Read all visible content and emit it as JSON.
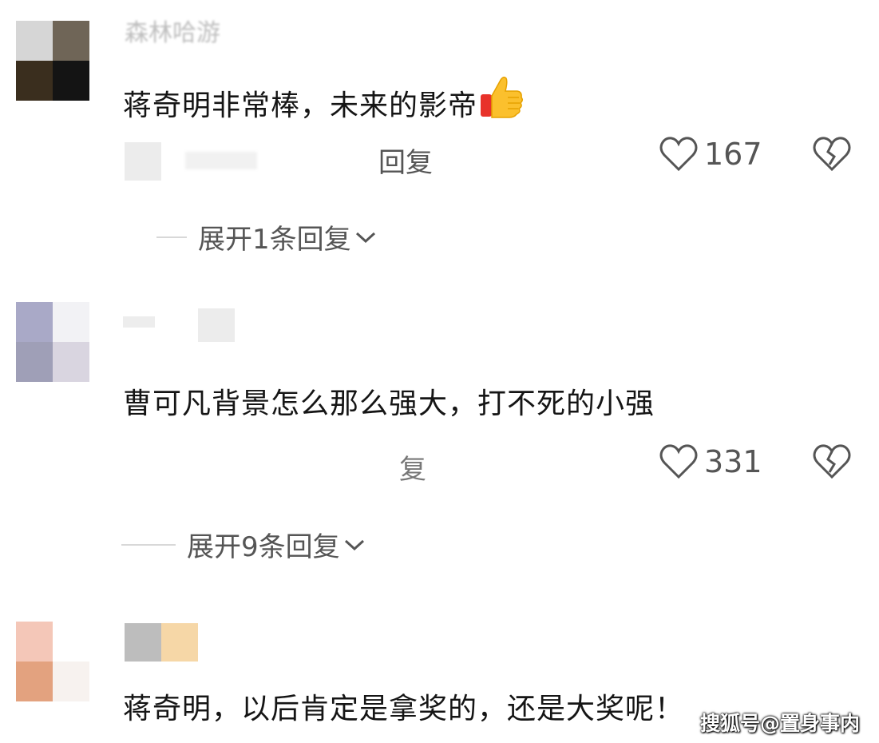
{
  "comments": [
    {
      "username": "森林哈游",
      "text": "蒋奇明非常棒，未来的影帝",
      "reply_label": "回复",
      "like_count": "167",
      "expand_label": "展开1条回复",
      "avatar_colors": [
        "#d6d6d6",
        "#6f6557",
        "#3a2e1e",
        "#141414"
      ]
    },
    {
      "username": "",
      "text": "曹可凡背景怎么那么强大，打不死的小强",
      "reply_label": "复",
      "like_count": "331",
      "expand_label": "展开9条回复",
      "avatar_colors": [
        "#a9a9c7",
        "#f2f2f5",
        "#9f9fb7",
        "#d9d5e0"
      ]
    },
    {
      "username": "",
      "text": "蒋奇明，以后肯定是拿奖的，还是大奖呢！",
      "avatar_colors": [
        "#f4c7b8",
        "#ffffff",
        "#e3a27f",
        "#f7f2ef"
      ],
      "name_block_colors": [
        "#bdbdbd",
        "#f6d7a7"
      ]
    }
  ],
  "watermark": "搜狐号@置身事内",
  "icons": {
    "thumb": "thumbs-up-emoji",
    "like": "heart-outline-icon",
    "dislike": "broken-heart-icon",
    "expand": "chevron-down-icon"
  }
}
